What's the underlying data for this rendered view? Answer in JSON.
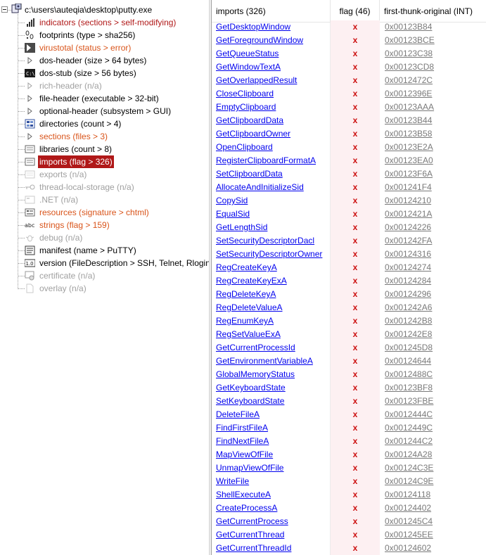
{
  "tree": {
    "root": {
      "label": "c:\\users\\auteqia\\desktop\\putty.exe",
      "icon": "exe-file-icon"
    },
    "items": [
      {
        "label": "indicators (sections > self-modifying)",
        "color": "#b01818",
        "icon": "bars-icon",
        "state": "normal"
      },
      {
        "label": "footprints (type > sha256)",
        "color": "#000000",
        "icon": "footprints-icon",
        "state": "normal"
      },
      {
        "label": "virustotal (status > error)",
        "color": "#d9541a",
        "icon": "virustotal-icon",
        "state": "normal"
      },
      {
        "label": "dos-header (size > 64 bytes)",
        "color": "#000000",
        "icon": "triangle-icon",
        "state": "normal"
      },
      {
        "label": "dos-stub (size > 56 bytes)",
        "color": "#000000",
        "icon": "console-icon",
        "state": "normal"
      },
      {
        "label": "rich-header (n/a)",
        "color": "#a0a0a0",
        "icon": "triangle-icon",
        "state": "disabled"
      },
      {
        "label": "file-header (executable > 32-bit)",
        "color": "#000000",
        "icon": "triangle-icon",
        "state": "normal"
      },
      {
        "label": "optional-header (subsystem > GUI)",
        "color": "#000000",
        "icon": "triangle-icon",
        "state": "normal"
      },
      {
        "label": "directories (count > 4)",
        "color": "#000000",
        "icon": "directories-icon",
        "state": "normal"
      },
      {
        "label": "sections (files > 3)",
        "color": "#d9541a",
        "icon": "triangle-icon",
        "state": "normal"
      },
      {
        "label": "libraries (count > 8)",
        "color": "#000000",
        "icon": "libraries-icon",
        "state": "normal"
      },
      {
        "label": "imports (flag > 326)",
        "color": "#ffffff",
        "icon": "imports-icon",
        "state": "selected"
      },
      {
        "label": "exports (n/a)",
        "color": "#a0a0a0",
        "icon": "exports-icon",
        "state": "disabled"
      },
      {
        "label": "thread-local-storage (n/a)",
        "color": "#a0a0a0",
        "icon": "key-icon",
        "state": "disabled"
      },
      {
        "label": ".NET (n/a)",
        "color": "#a0a0a0",
        "icon": "dotnet-icon",
        "state": "disabled"
      },
      {
        "label": "resources (signature > chtml)",
        "color": "#d9541a",
        "icon": "resources-icon",
        "state": "normal"
      },
      {
        "label": "strings (flag > 159)",
        "color": "#d9541a",
        "icon": "abc-icon",
        "state": "normal"
      },
      {
        "label": "debug (n/a)",
        "color": "#a0a0a0",
        "icon": "bug-icon",
        "state": "disabled"
      },
      {
        "label": "manifest (name > PuTTY)",
        "color": "#000000",
        "icon": "manifest-icon",
        "state": "normal"
      },
      {
        "label": "version (FileDescription > SSH, Telnet, Rlogin,",
        "color": "#000000",
        "icon": "version-icon",
        "state": "normal"
      },
      {
        "label": "certificate (n/a)",
        "color": "#a0a0a0",
        "icon": "certificate-icon",
        "state": "disabled"
      },
      {
        "label": "overlay (n/a)",
        "color": "#a0a0a0",
        "icon": "page-icon",
        "state": "disabled"
      }
    ]
  },
  "table": {
    "columns": [
      "imports (326)",
      "flag (46)",
      "first-thunk-original (INT)"
    ],
    "flag_mark": "x",
    "rows": [
      [
        "GetDesktopWindow",
        "x",
        "0x00123B84"
      ],
      [
        "GetForegroundWindow",
        "x",
        "0x00123BCE"
      ],
      [
        "GetQueueStatus",
        "x",
        "0x00123C38"
      ],
      [
        "GetWindowTextA",
        "x",
        "0x00123CD8"
      ],
      [
        "GetOverlappedResult",
        "x",
        "0x0012472C"
      ],
      [
        "CloseClipboard",
        "x",
        "0x0012396E"
      ],
      [
        "EmptyClipboard",
        "x",
        "0x00123AAA"
      ],
      [
        "GetClipboardData",
        "x",
        "0x00123B44"
      ],
      [
        "GetClipboardOwner",
        "x",
        "0x00123B58"
      ],
      [
        "OpenClipboard",
        "x",
        "0x00123E2A"
      ],
      [
        "RegisterClipboardFormatA",
        "x",
        "0x00123EA0"
      ],
      [
        "SetClipboardData",
        "x",
        "0x00123F6A"
      ],
      [
        "AllocateAndInitializeSid",
        "x",
        "0x001241F4"
      ],
      [
        "CopySid",
        "x",
        "0x00124210"
      ],
      [
        "EqualSid",
        "x",
        "0x0012421A"
      ],
      [
        "GetLengthSid",
        "x",
        "0x00124226"
      ],
      [
        "SetSecurityDescriptorDacl",
        "x",
        "0x001242FA"
      ],
      [
        "SetSecurityDescriptorOwner",
        "x",
        "0x00124316"
      ],
      [
        "RegCreateKeyA",
        "x",
        "0x00124274"
      ],
      [
        "RegCreateKeyExA",
        "x",
        "0x00124284"
      ],
      [
        "RegDeleteKeyA",
        "x",
        "0x00124296"
      ],
      [
        "RegDeleteValueA",
        "x",
        "0x001242A6"
      ],
      [
        "RegEnumKeyA",
        "x",
        "0x001242B8"
      ],
      [
        "RegSetValueExA",
        "x",
        "0x001242E8"
      ],
      [
        "GetCurrentProcessId",
        "x",
        "0x001245D8"
      ],
      [
        "GetEnvironmentVariableA",
        "x",
        "0x00124644"
      ],
      [
        "GlobalMemoryStatus",
        "x",
        "0x0012488C"
      ],
      [
        "GetKeyboardState",
        "x",
        "0x00123BF8"
      ],
      [
        "SetKeyboardState",
        "x",
        "0x00123FBE"
      ],
      [
        "DeleteFileA",
        "x",
        "0x0012444C"
      ],
      [
        "FindFirstFileA",
        "x",
        "0x0012449C"
      ],
      [
        "FindNextFileA",
        "x",
        "0x001244C2"
      ],
      [
        "MapViewOfFile",
        "x",
        "0x00124A28"
      ],
      [
        "UnmapViewOfFile",
        "x",
        "0x00124C3E"
      ],
      [
        "WriteFile",
        "x",
        "0x00124C9E"
      ],
      [
        "ShellExecuteA",
        "x",
        "0x00124118"
      ],
      [
        "CreateProcessA",
        "x",
        "0x00124402"
      ],
      [
        "GetCurrentProcess",
        "x",
        "0x001245C4"
      ],
      [
        "GetCurrentThread",
        "x",
        "0x001245EE"
      ],
      [
        "GetCurrentThreadId",
        "x",
        "0x00124602"
      ]
    ]
  }
}
